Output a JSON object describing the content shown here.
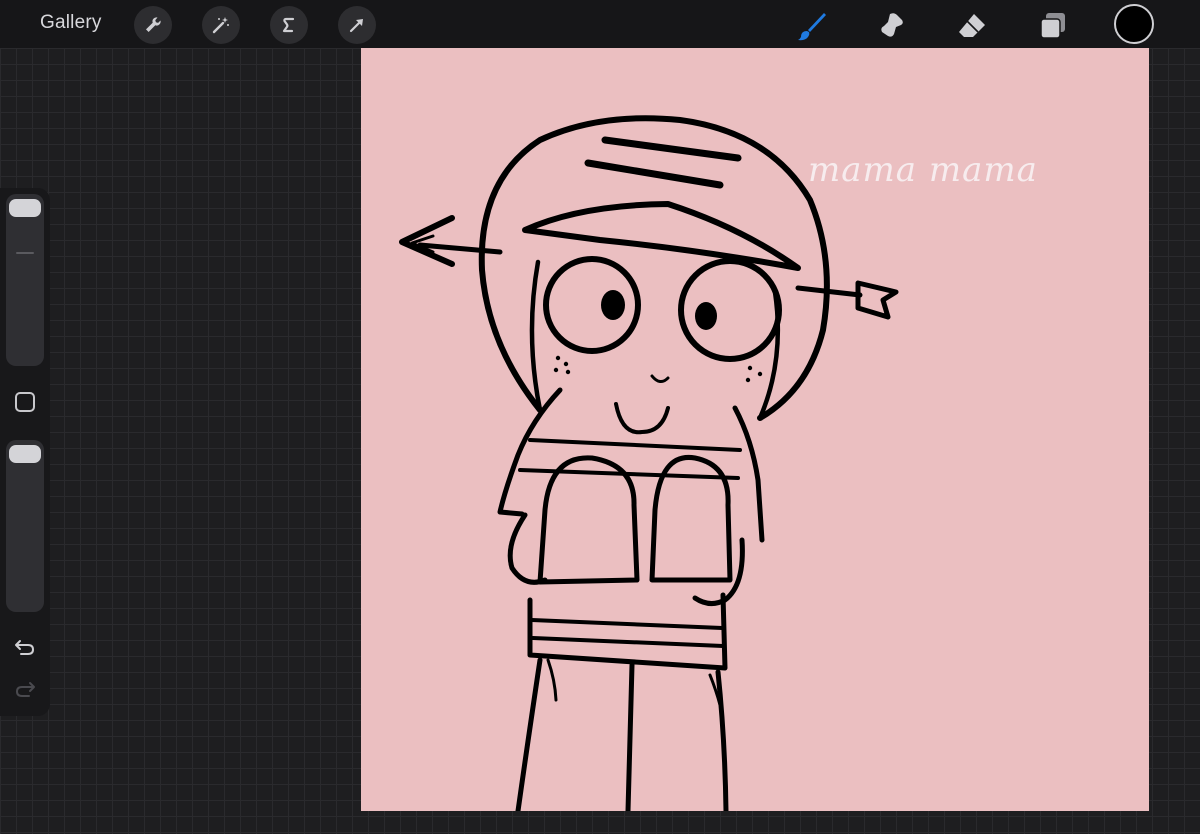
{
  "header": {
    "gallery_label": "Gallery",
    "left_tools": [
      "wrench-icon",
      "magic-wand-icon",
      "selection-s-icon",
      "transform-arrow-icon"
    ],
    "right_tools": [
      "brush-icon",
      "smudge-icon",
      "eraser-icon",
      "layers-icon"
    ],
    "active_tool": "brush-icon",
    "current_color": "#000000",
    "active_tool_color": "#1f7ae0"
  },
  "sidebar": {
    "brush_size_level": 0.0,
    "opacity_level": 0.0,
    "modify_button": "square-icon",
    "undo": "undo-icon",
    "redo": "redo-icon"
  },
  "canvas": {
    "background_color": "#ebbfc1",
    "watermark_text": "mama mama"
  }
}
